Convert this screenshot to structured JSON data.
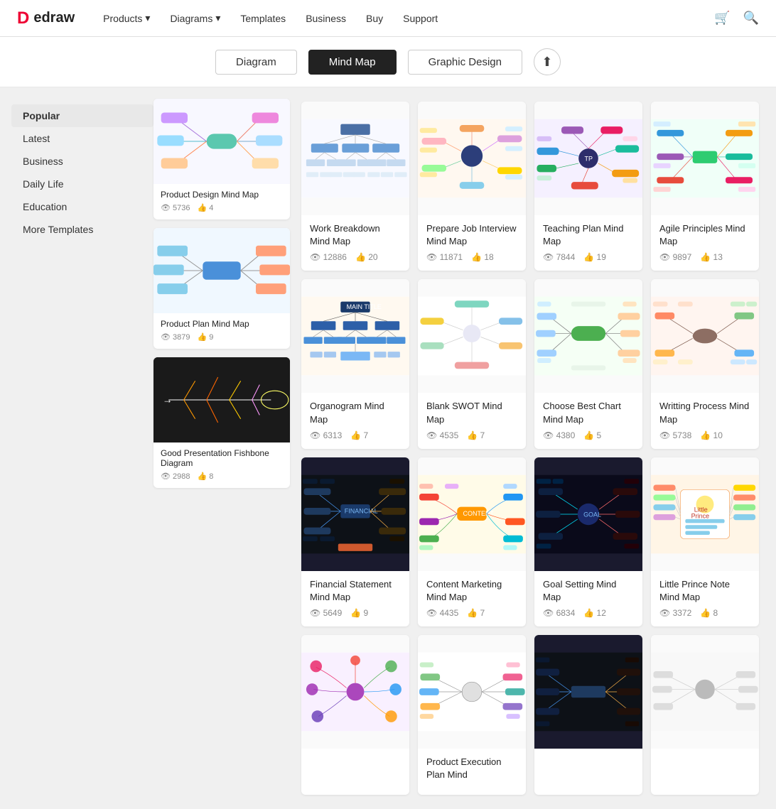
{
  "nav": {
    "logo_text": "edraw",
    "links": [
      {
        "label": "Products",
        "has_arrow": true
      },
      {
        "label": "Diagrams",
        "has_arrow": true
      },
      {
        "label": "Templates",
        "has_arrow": false
      },
      {
        "label": "Business",
        "has_arrow": false
      },
      {
        "label": "Buy",
        "has_arrow": false
      },
      {
        "label": "Support",
        "has_arrow": false
      }
    ]
  },
  "tabs": {
    "buttons": [
      "Diagram",
      "Mind Map",
      "Graphic Design"
    ],
    "active": "Mind Map"
  },
  "sidebar": {
    "items": [
      {
        "label": "Popular",
        "active": true
      },
      {
        "label": "Latest",
        "active": false
      },
      {
        "label": "Business",
        "active": false
      },
      {
        "label": "Daily Life",
        "active": false
      },
      {
        "label": "Education",
        "active": false
      },
      {
        "label": "More Templates",
        "active": false
      }
    ]
  },
  "sidebar_cards": [
    {
      "title": "Product Design Mind Map",
      "views": "5736",
      "likes": "4",
      "thumb_type": "light_mindmap_1"
    },
    {
      "title": "Product Plan Mind Map",
      "views": "3879",
      "likes": "9",
      "thumb_type": "light_mindmap_2"
    },
    {
      "title": "Good Presentation Fishbone Diagram",
      "views": "2988",
      "likes": "8",
      "thumb_type": "dark_fishbone"
    }
  ],
  "cards": [
    {
      "title": "Work Breakdown Mind Map",
      "views": "12886",
      "likes": "20",
      "thumb_type": "wbs"
    },
    {
      "title": "Prepare Job Interview Mind Map",
      "views": "11871",
      "likes": "18",
      "thumb_type": "job_interview"
    },
    {
      "title": "Teaching Plan Mind Map",
      "views": "7844",
      "likes": "19",
      "thumb_type": "teaching_plan"
    },
    {
      "title": "Agile Principles Mind Map",
      "views": "9897",
      "likes": "13",
      "thumb_type": "agile"
    },
    {
      "title": "Organogram Mind Map",
      "views": "6313",
      "likes": "7",
      "thumb_type": "organogram"
    },
    {
      "title": "Blank SWOT Mind Map",
      "views": "4535",
      "likes": "7",
      "thumb_type": "swot"
    },
    {
      "title": "Choose Best Chart Mind Map",
      "views": "4380",
      "likes": "5",
      "thumb_type": "choose_chart"
    },
    {
      "title": "Writting Process Mind Map",
      "views": "5738",
      "likes": "10",
      "thumb_type": "writing_process"
    },
    {
      "title": "Financial Statement Mind Map",
      "views": "5649",
      "likes": "9",
      "thumb_type": "financial_dark"
    },
    {
      "title": "Content Marketing Mind Map",
      "views": "4435",
      "likes": "7",
      "thumb_type": "content_marketing"
    },
    {
      "title": "Goal Setting Mind Map",
      "views": "6834",
      "likes": "12",
      "thumb_type": "goal_setting_dark"
    },
    {
      "title": "Little Prince Note Mind Map",
      "views": "3372",
      "likes": "8",
      "thumb_type": "little_prince"
    },
    {
      "title": "",
      "views": "",
      "likes": "",
      "thumb_type": "plant_mind"
    },
    {
      "title": "Product Execution Plan Mind",
      "views": "",
      "likes": "",
      "thumb_type": "product_execution"
    },
    {
      "title": "",
      "views": "",
      "likes": "",
      "thumb_type": "dark_branches"
    },
    {
      "title": "",
      "views": "",
      "likes": "",
      "thumb_type": "placeholder"
    }
  ],
  "icons": {
    "eye": "👁",
    "like": "👍",
    "cart": "🛒",
    "search": "🔍",
    "upload": "⬆",
    "arrow": "▾"
  }
}
